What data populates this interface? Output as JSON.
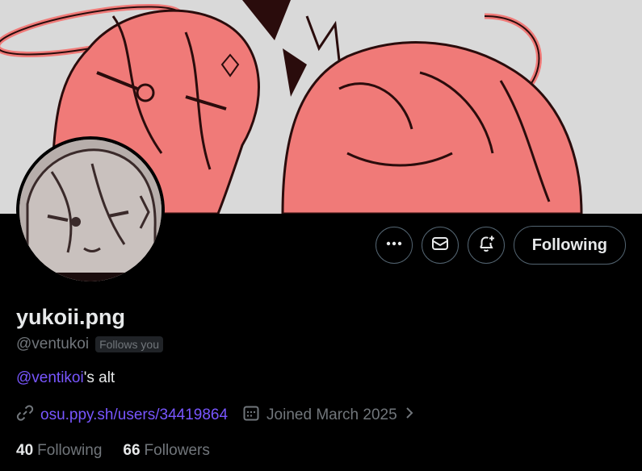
{
  "profile": {
    "display_name": "yukoii.png",
    "handle": "@ventukoi",
    "follows_you": "Follows you",
    "bio_mention": "@ventikoi",
    "bio_rest": "'s alt",
    "website": "osu.ppy.sh/users/34419864",
    "joined": "Joined March 2025"
  },
  "actions": {
    "more_icon": "more-icon",
    "message_icon": "envelope-icon",
    "notify_icon": "bell-plus-icon",
    "following_label": "Following"
  },
  "stats": {
    "following_count": "40",
    "following_label": "Following",
    "followers_count": "66",
    "followers_label": "Followers"
  },
  "colors": {
    "accent": "#7856ff",
    "muted": "#71767b",
    "text": "#e7e9ea",
    "background": "#000000",
    "banner_pink": "#f07a78"
  }
}
